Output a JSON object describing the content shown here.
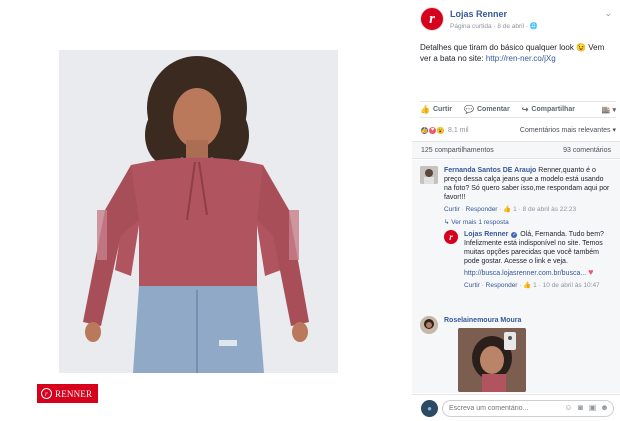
{
  "photo": {
    "brand_logo": "RENNER",
    "brand_logo_mark": "r"
  },
  "post": {
    "page_name": "Lojas Renner",
    "avatar_mark": "r",
    "meta": "Página curtida · 8 de abril · ",
    "text_main": "Detalhes que tiram do básico qualquer look 😉 Vem ver a bata no site: ",
    "text_link": "http://ren-ner.co/jXg",
    "actions": {
      "like": "Curtir",
      "comment": "Comentar",
      "share": "Compartilhar"
    },
    "reactions_count": "8,1 mil",
    "sort_label": "Comentários mais relevantes ▾",
    "shares": "125 compartilhamentos",
    "comments_count": "93 comentários"
  },
  "comments": [
    {
      "author": "Fernanda Santos DE Araujo",
      "text": "Renner,quanto é o preço dessa calça jeans que a modelo está usando na foto? Só quero saber isso,me respondam aqui por favor!!!",
      "like": "Curtir",
      "reply": "Responder",
      "likes": "1",
      "time": "8 de abril às 22:23",
      "replies_label": "↳ Ver mais 1 resposta"
    },
    {
      "author": "Lojas Renner",
      "text": "Olá, Fernanda. Tudo bem? Infelizmente está indisponível no site. Temos muitas opções parecidas que você também pode gostar. Acesse o link e veja.",
      "link": "http://busca.lojasrenner.com.br/busca...",
      "like": "Curtir",
      "reply": "Responder",
      "likes": "1",
      "time": "10 de abril às 10:47"
    },
    {
      "author": "Roselainemoura Moura"
    }
  ],
  "composer": {
    "placeholder": "Escreva um comentário..."
  },
  "colors": {
    "brand": "#d6001c",
    "link": "#365899",
    "panel": "#f6f7f9"
  }
}
